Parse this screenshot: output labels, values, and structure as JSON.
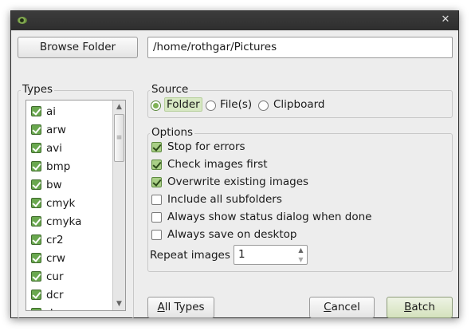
{
  "window": {
    "close_glyph": "✕"
  },
  "browse_button": "Browse Folder",
  "path": "/home/rothgar/Pictures",
  "types": {
    "label": "Types",
    "items": [
      {
        "label": "ai",
        "checked": true
      },
      {
        "label": "arw",
        "checked": true
      },
      {
        "label": "avi",
        "checked": true
      },
      {
        "label": "bmp",
        "checked": true
      },
      {
        "label": "bw",
        "checked": true
      },
      {
        "label": "cmyk",
        "checked": true
      },
      {
        "label": "cmyka",
        "checked": true
      },
      {
        "label": "cr2",
        "checked": true
      },
      {
        "label": "crw",
        "checked": true
      },
      {
        "label": "cur",
        "checked": true
      },
      {
        "label": "dcr",
        "checked": true
      },
      {
        "label": "dc",
        "checked": true
      }
    ]
  },
  "source": {
    "label": "Source",
    "options": [
      {
        "label": "Folder",
        "selected": true
      },
      {
        "label": "File(s)",
        "selected": false
      },
      {
        "label": "Clipboard",
        "selected": false
      }
    ]
  },
  "options": {
    "label": "Options",
    "items": [
      {
        "label": "Stop for errors",
        "checked": true
      },
      {
        "label": "Check images first",
        "checked": true
      },
      {
        "label": "Overwrite existing images",
        "checked": true
      },
      {
        "label": "Include all subfolders",
        "checked": false
      },
      {
        "label": "Always show status dialog when done",
        "checked": false
      },
      {
        "label": "Always save on desktop",
        "checked": false
      }
    ],
    "repeat_label": "Repeat images",
    "repeat_value": "1"
  },
  "buttons": {
    "all_types_mnemonic": "A",
    "all_types_rest": "ll Types",
    "cancel_mnemonic": "C",
    "cancel_rest": "ancel",
    "batch_mnemonic": "B",
    "batch_rest": "atch"
  },
  "colors": {
    "accent": "#6aa84f",
    "titlebar": "#333333"
  }
}
